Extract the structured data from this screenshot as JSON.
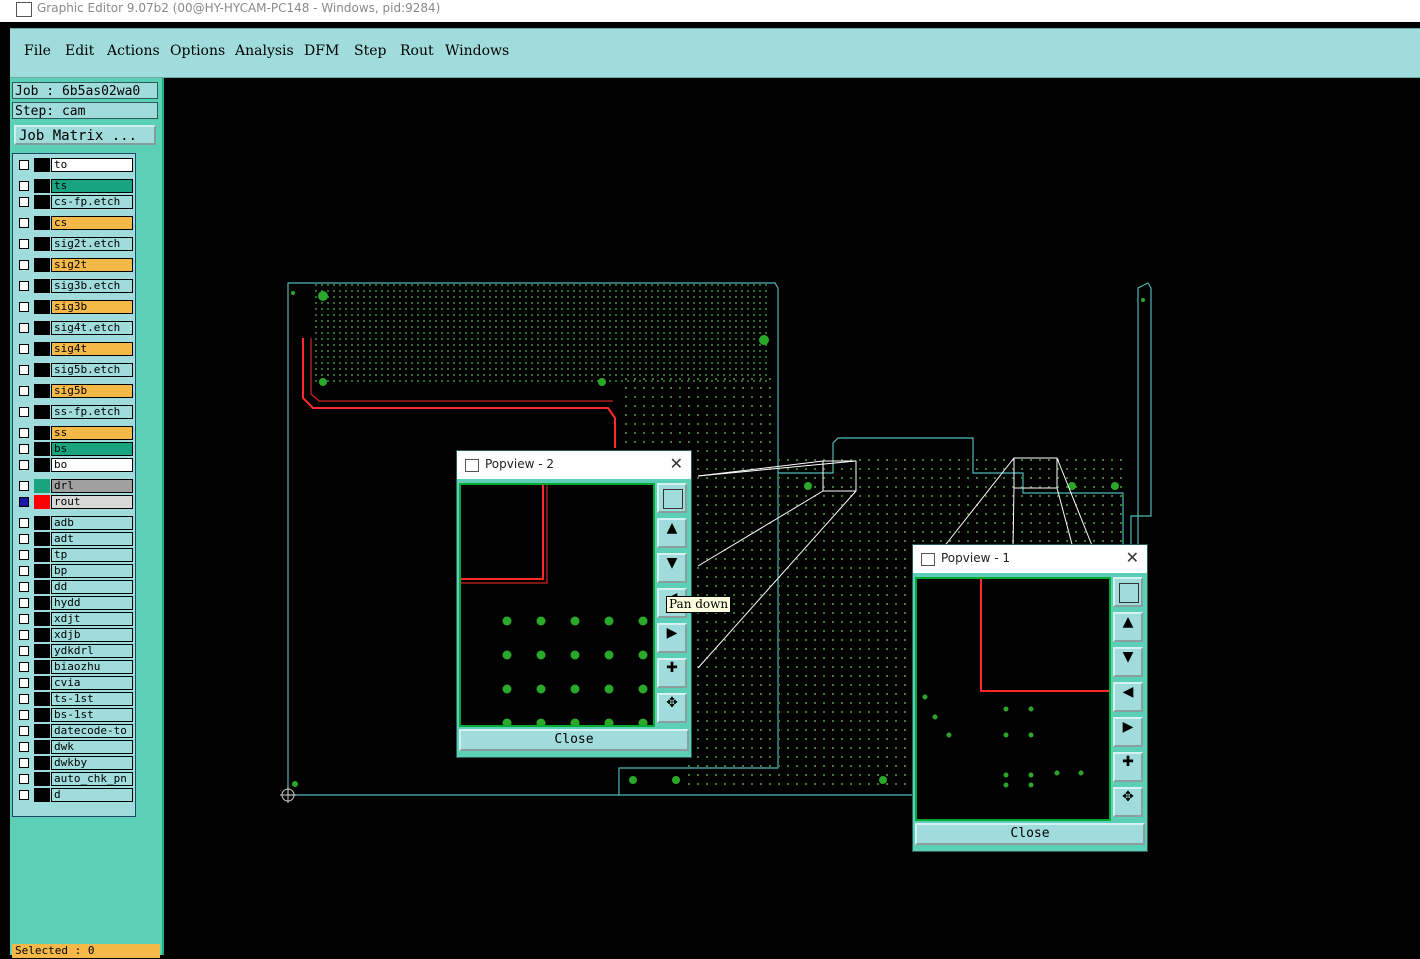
{
  "window": {
    "title": "Graphic Editor 9.07b2 (00@HY-HYCAM-PC148 - Windows, pid:9284)"
  },
  "menu": [
    {
      "label": "File"
    },
    {
      "label": "Edit"
    },
    {
      "label": "Actions"
    },
    {
      "label": "Options"
    },
    {
      "label": "Analysis"
    },
    {
      "label": "DFM"
    },
    {
      "label": "Step"
    },
    {
      "label": "Rout"
    },
    {
      "label": "Windows"
    }
  ],
  "job": {
    "job_label": "Job : 6b5as02wa0",
    "step_label": "Step: cam",
    "matrix_button": "Job Matrix ..."
  },
  "layers": [
    {
      "name": "to",
      "color": "#ffffff",
      "swatch": "#000000"
    },
    {
      "name": "ts",
      "color": "#1aa37f",
      "swatch": "#000000"
    },
    {
      "name": "cs-fp.etch",
      "color": "#a0dcdc",
      "swatch": "#000000"
    },
    {
      "name": "cs",
      "color": "#f5b94a",
      "swatch": "#000000"
    },
    {
      "name": "sig2t.etch",
      "color": "#a0dcdc",
      "swatch": "#000000"
    },
    {
      "name": "sig2t",
      "color": "#f5b94a",
      "swatch": "#000000"
    },
    {
      "name": "sig3b.etch",
      "color": "#a0dcdc",
      "swatch": "#000000"
    },
    {
      "name": "sig3b",
      "color": "#f5b94a",
      "swatch": "#000000"
    },
    {
      "name": "sig4t.etch",
      "color": "#a0dcdc",
      "swatch": "#000000"
    },
    {
      "name": "sig4t",
      "color": "#f5b94a",
      "swatch": "#000000"
    },
    {
      "name": "sig5b.etch",
      "color": "#a0dcdc",
      "swatch": "#000000"
    },
    {
      "name": "sig5b",
      "color": "#f5b94a",
      "swatch": "#000000"
    },
    {
      "name": "ss-fp.etch",
      "color": "#a0dcdc",
      "swatch": "#000000"
    },
    {
      "name": "ss",
      "color": "#f5b94a",
      "swatch": "#000000"
    },
    {
      "name": "bs",
      "color": "#1aa37f",
      "swatch": "#000000"
    },
    {
      "name": "bo",
      "color": "#ffffff",
      "swatch": "#000000"
    },
    {
      "name": "drl",
      "color": "#a0a0a0",
      "swatch": "#1aa37f"
    },
    {
      "name": "rout",
      "color": "#d8d8d8",
      "swatch": "#ff0000"
    },
    {
      "name": "adb",
      "color": "#a0dcdc",
      "swatch": "#000000"
    },
    {
      "name": "adt",
      "color": "#a0dcdc",
      "swatch": "#000000"
    },
    {
      "name": "tp",
      "color": "#a0dcdc",
      "swatch": "#000000"
    },
    {
      "name": "bp",
      "color": "#a0dcdc",
      "swatch": "#000000"
    },
    {
      "name": "dd",
      "color": "#a0dcdc",
      "swatch": "#000000"
    },
    {
      "name": "hydd",
      "color": "#a0dcdc",
      "swatch": "#000000"
    },
    {
      "name": "xdjt",
      "color": "#a0dcdc",
      "swatch": "#000000"
    },
    {
      "name": "xdjb",
      "color": "#a0dcdc",
      "swatch": "#000000"
    },
    {
      "name": "ydkdrl",
      "color": "#a0dcdc",
      "swatch": "#000000"
    },
    {
      "name": "biaozhu",
      "color": "#a0dcdc",
      "swatch": "#000000"
    },
    {
      "name": "cvia",
      "color": "#a0dcdc",
      "swatch": "#000000"
    },
    {
      "name": "ts-1st",
      "color": "#a0dcdc",
      "swatch": "#000000"
    },
    {
      "name": "bs-1st",
      "color": "#a0dcdc",
      "swatch": "#000000"
    },
    {
      "name": "datecode-to",
      "color": "#a0dcdc",
      "swatch": "#000000"
    },
    {
      "name": "dwk",
      "color": "#a0dcdc",
      "swatch": "#000000"
    },
    {
      "name": "dwkby",
      "color": "#a0dcdc",
      "swatch": "#000000"
    },
    {
      "name": "auto_chk_pn",
      "color": "#a0dcdc",
      "swatch": "#000000"
    },
    {
      "name": "d",
      "color": "#a0dcdc",
      "swatch": "#000000"
    }
  ],
  "status": {
    "selected": "Selected : 0"
  },
  "popview2": {
    "title": "Popview - 2",
    "close": "Close"
  },
  "popview1": {
    "title": "Popview - 1",
    "close": "Close"
  },
  "tooltip": "Pan down",
  "colors": {
    "board_outline": "#4fb8b8",
    "trace": "#ff2a2a",
    "pads": "#2aa82a",
    "selection": "#ffffff"
  }
}
